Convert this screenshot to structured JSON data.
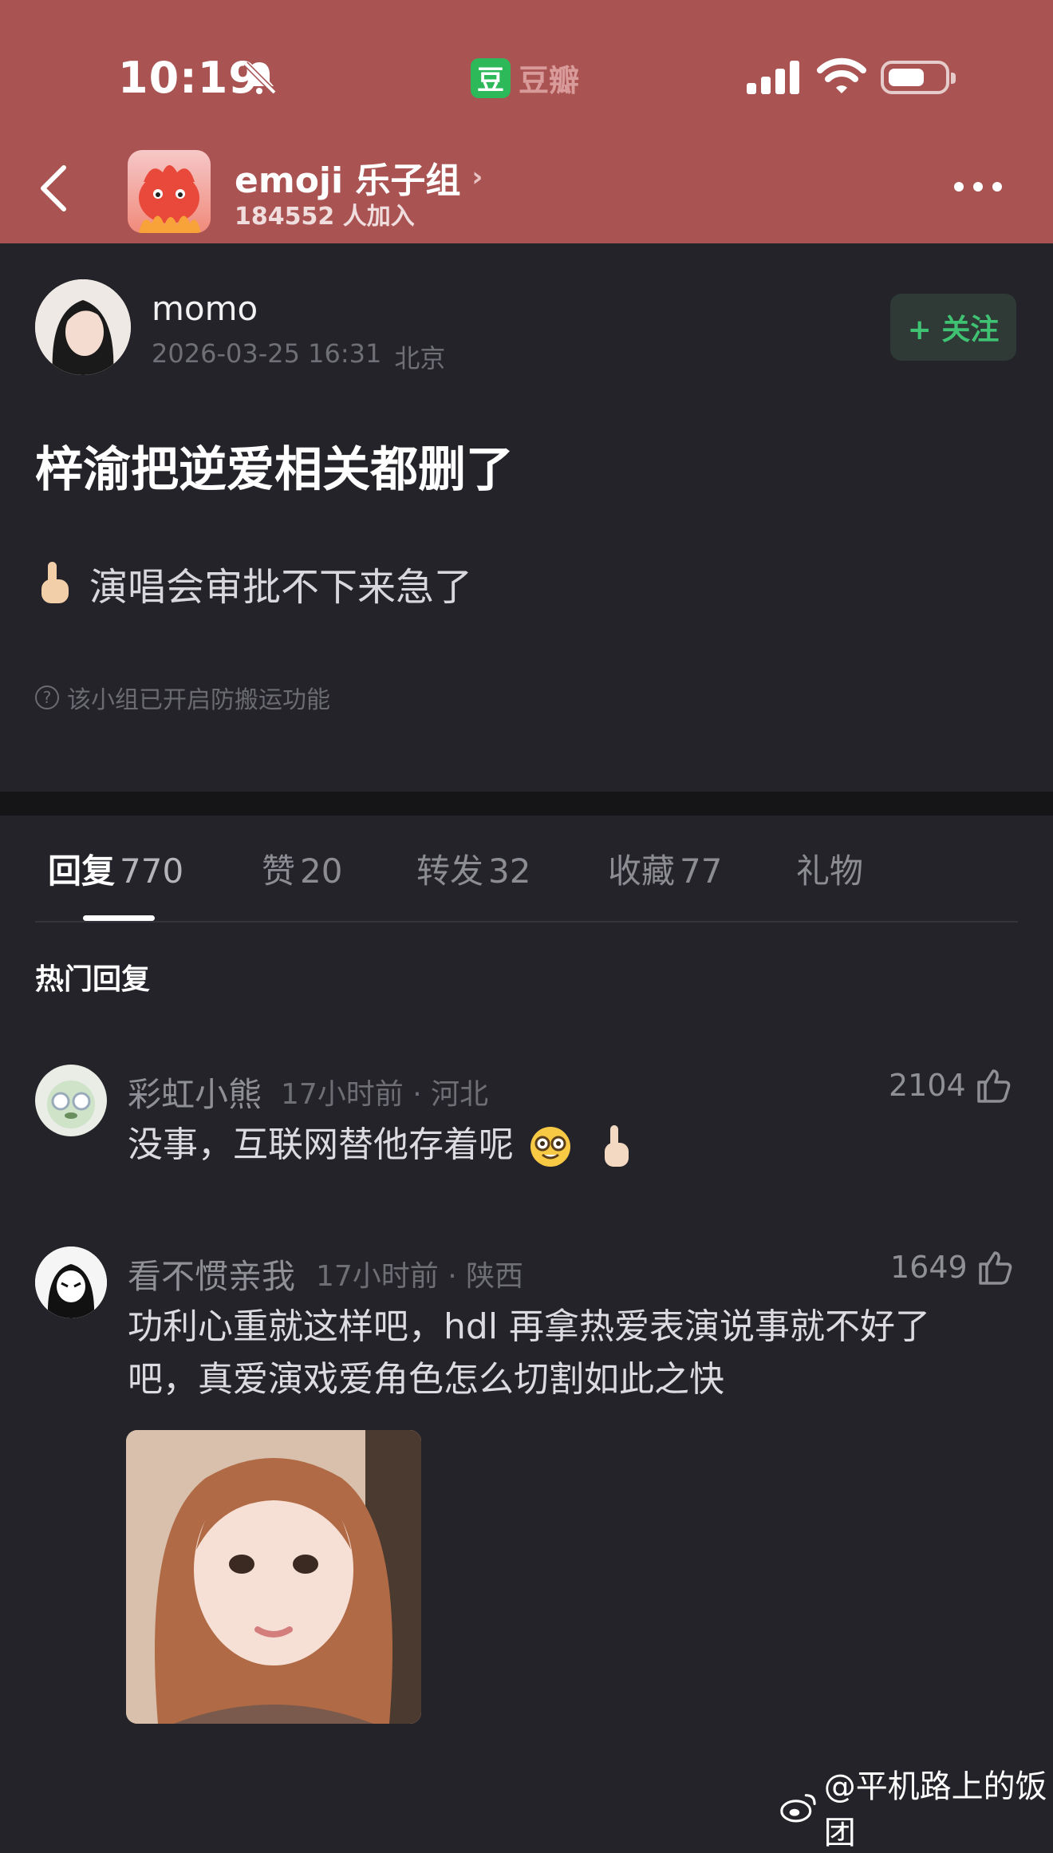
{
  "status_bar": {
    "time": "10:19",
    "app_name": "豆瓣",
    "app_logo": "豆"
  },
  "group": {
    "title": "emoji 乐子组",
    "members": "184552 人加入"
  },
  "post": {
    "author": "momo",
    "datetime": "2026-03-25 16:31",
    "location": "北京",
    "follow_label": "+ 关注",
    "title": "梓渝把逆爱相关都删了",
    "body": "演唱会审批不下来急了",
    "notice": "该小组已开启防搬运功能"
  },
  "tabs": [
    {
      "label": "回复",
      "count": "770"
    },
    {
      "label": "赞",
      "count": "20"
    },
    {
      "label": "转发",
      "count": "32"
    },
    {
      "label": "收藏",
      "count": "77"
    },
    {
      "label": "礼物",
      "count": ""
    }
  ],
  "hot_replies_title": "热门回复",
  "comments": [
    {
      "name": "彩虹小熊",
      "meta": "17小时前 · 河北",
      "likes": "2104",
      "text": "没事，互联网替他存着呢"
    },
    {
      "name": "看不惯亲我",
      "meta": "17小时前 · 陕西",
      "likes": "1649",
      "text_line1": "功利心重就这样吧，hdl 再拿热爱表演说事就不好了",
      "text_line2": "吧，真爱演戏爱角色怎么切割如此之快"
    }
  ],
  "watermark": "@平机路上的饭团",
  "colors": {
    "header": "#aa5353",
    "background": "#232329",
    "follow_green": "#3fc373"
  },
  "icons": [
    "bell-muted-icon",
    "signal-icon",
    "wifi-icon",
    "battery-icon",
    "back-chevron-icon",
    "more-dots-icon",
    "thumbs-up-icon",
    "pointing-up-emoji",
    "nerd-face-emoji",
    "weibo-logo-icon"
  ]
}
